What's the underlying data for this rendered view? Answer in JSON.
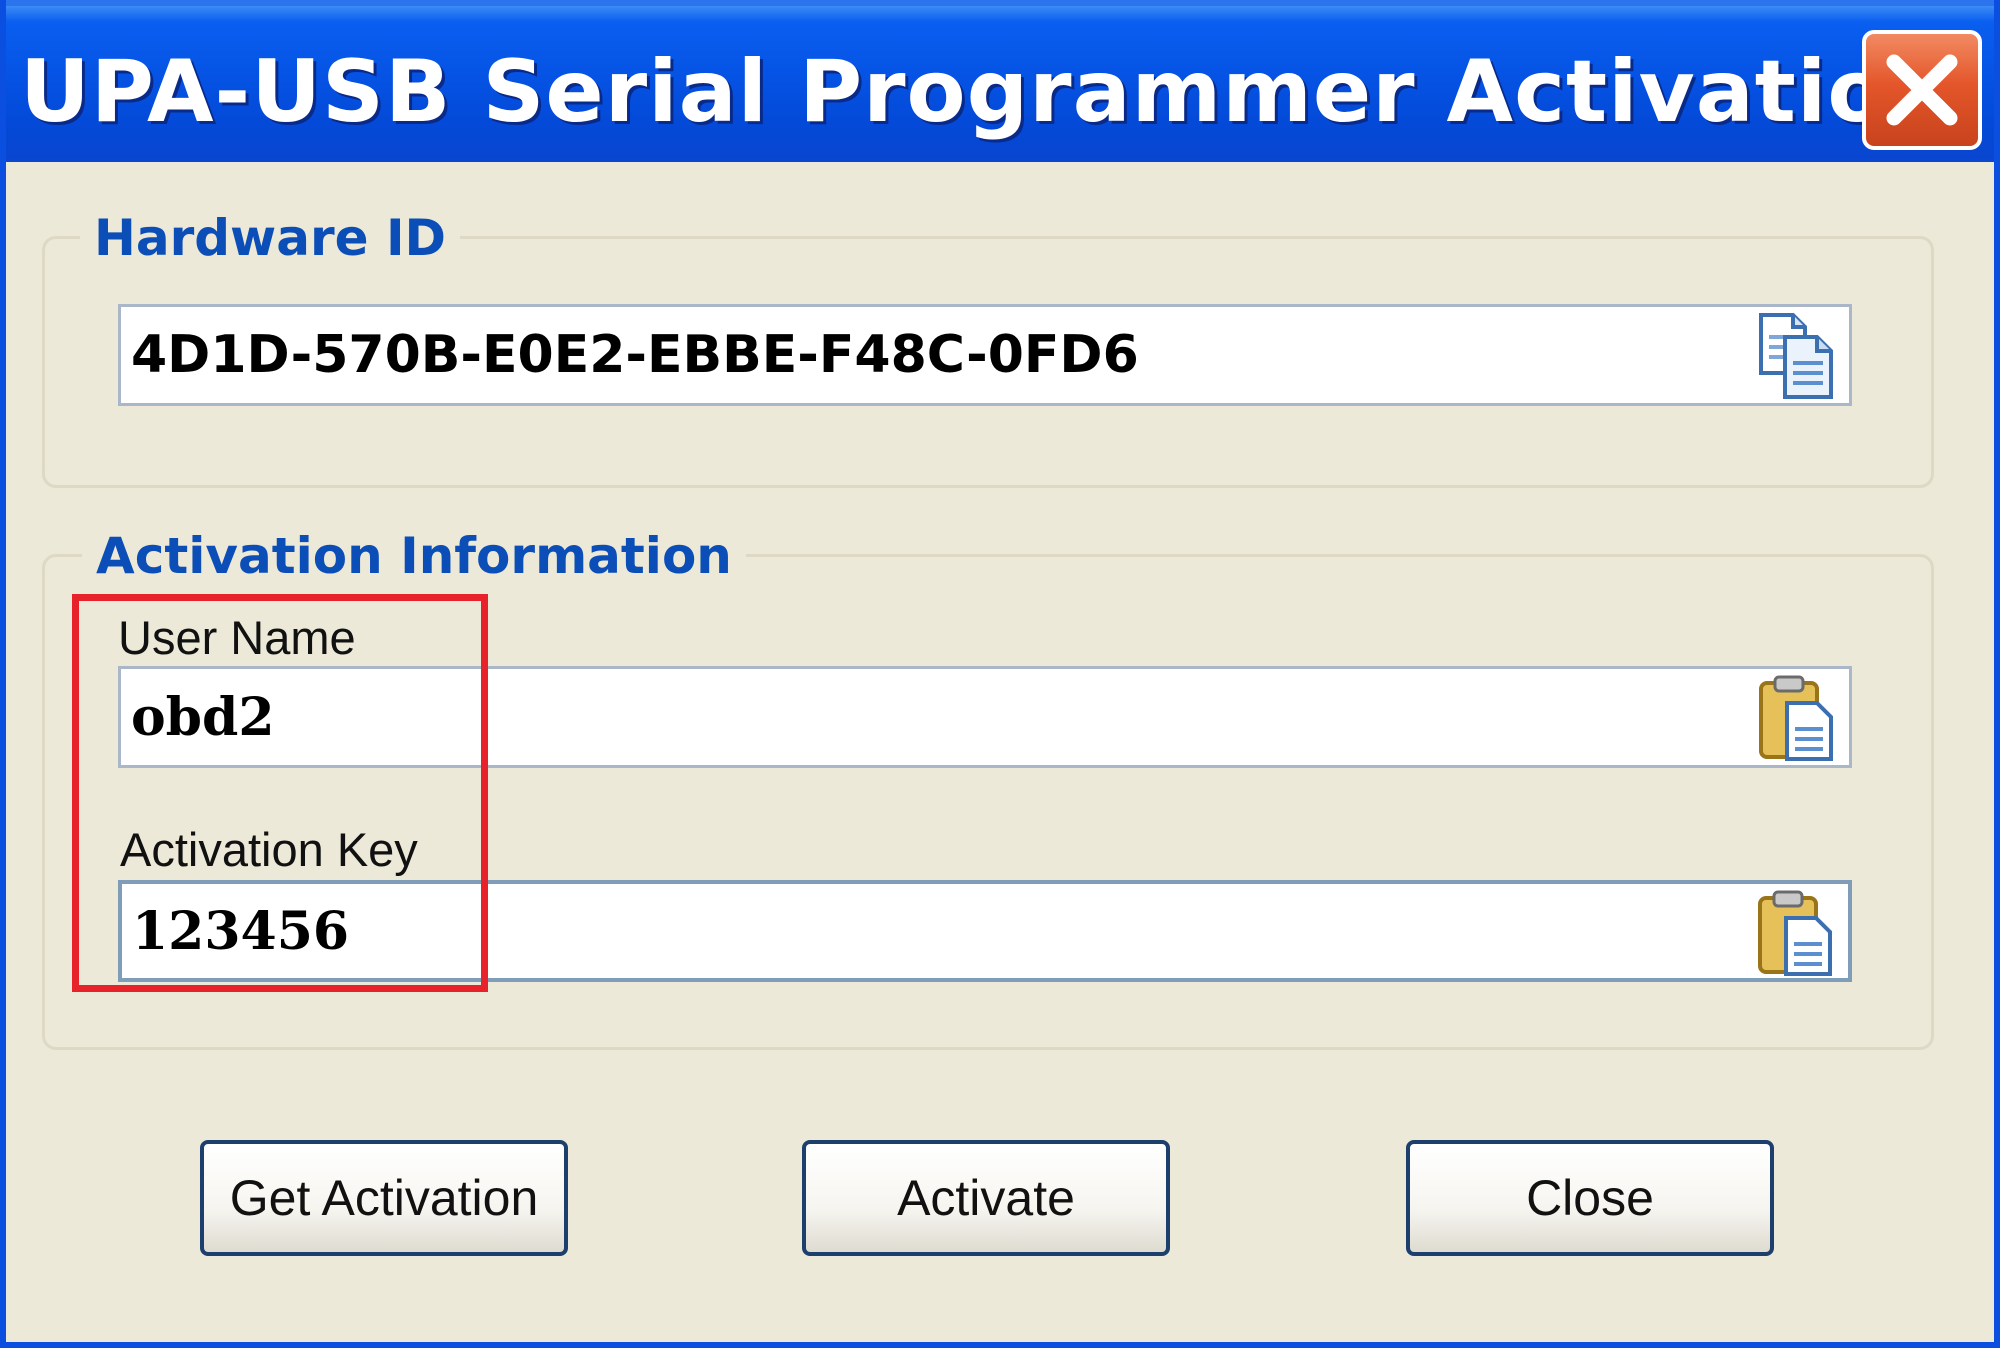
{
  "window": {
    "title": "UPA-USB Serial Programmer Activation"
  },
  "icons": {
    "close": "close-x-icon",
    "copy": "copy-icon",
    "paste": "clipboard-paste-icon"
  },
  "hardware_id_group": {
    "legend": "Hardware ID",
    "value": "4D1D-570B-E0E2-EBBE-F48C-0FD6"
  },
  "activation_group": {
    "legend": "Activation Information",
    "user_name_label": "User Name",
    "user_name_value": "obd2",
    "activation_key_label": "Activation Key",
    "activation_key_value": "123456"
  },
  "buttons": {
    "get_activation": "Get Activation",
    "activate": "Activate",
    "close": "Close"
  },
  "colors": {
    "titlebar": "#0553e4",
    "dialog_background": "#ece9d8",
    "group_legend": "#0c4eb8",
    "highlight_box": "#e8222a"
  }
}
